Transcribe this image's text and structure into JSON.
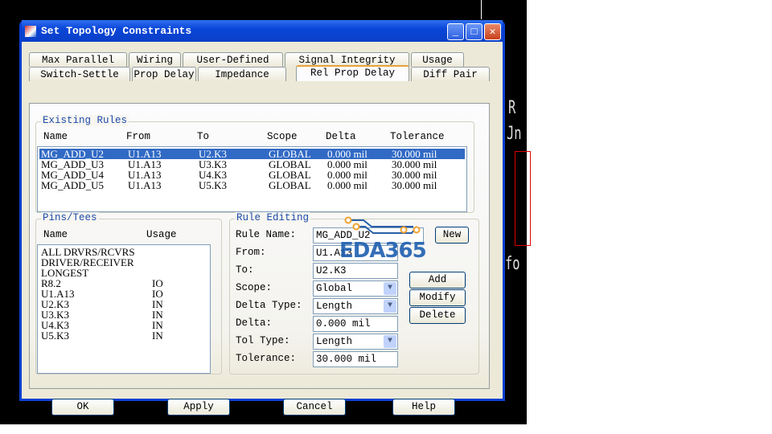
{
  "window": {
    "title": "Set Topology Constraints"
  },
  "tabs_row1": [
    "Max Parallel",
    "Wiring",
    "User-Defined",
    "Signal Integrity",
    "Usage"
  ],
  "tabs_row2": [
    "Switch-Settle",
    "Prop Delay",
    "Impedance",
    "Rel Prop Delay",
    "Diff Pair"
  ],
  "existing_rules": {
    "legend": "Existing Rules",
    "columns": [
      "Name",
      "From",
      "To",
      "Scope",
      "Delta",
      "Tolerance"
    ],
    "rows": [
      [
        "MG_ADD_U2",
        "U1.A13",
        "U2.K3",
        "GLOBAL",
        "0.000 mil",
        "30.000 mil"
      ],
      [
        "MG_ADD_U3",
        "U1.A13",
        "U3.K3",
        "GLOBAL",
        "0.000 mil",
        "30.000 mil"
      ],
      [
        "MG_ADD_U4",
        "U1.A13",
        "U4.K3",
        "GLOBAL",
        "0.000 mil",
        "30.000 mil"
      ],
      [
        "MG_ADD_U5",
        "U1.A13",
        "U5.K3",
        "GLOBAL",
        "0.000 mil",
        "30.000 mil"
      ]
    ]
  },
  "pins_tees": {
    "legend": "Pins/Tees",
    "columns": [
      "Name",
      "Usage"
    ],
    "rows": [
      [
        "ALL DRVRS/RCVRS",
        ""
      ],
      [
        "DRIVER/RECEIVER",
        ""
      ],
      [
        "LONGEST",
        ""
      ],
      [
        "R8.2",
        "IO"
      ],
      [
        "U1.A13",
        "IO"
      ],
      [
        "U2.K3",
        "IN"
      ],
      [
        "U3.K3",
        "IN"
      ],
      [
        "U4.K3",
        "IN"
      ],
      [
        "U5.K3",
        "IN"
      ]
    ]
  },
  "rule_editing": {
    "legend": "Rule Editing",
    "rule_name_label": "Rule Name:",
    "rule_name": "MG_ADD_U2",
    "from_label": "From:",
    "from": "U1.A13",
    "to_label": "To:",
    "to": "U2.K3",
    "scope_label": "Scope:",
    "scope": "Global",
    "delta_type_label": "Delta Type:",
    "delta_type": "Length",
    "delta_label": "Delta:",
    "delta": "0.000 mil",
    "tol_type_label": "Tol Type:",
    "tol_type": "Length",
    "tolerance_label": "Tolerance:",
    "tolerance": "30.000 mil",
    "new": "New",
    "add": "Add",
    "modify": "Modify",
    "delete": "Delete"
  },
  "buttons": {
    "ok": "OK",
    "apply": "Apply",
    "cancel": "Cancel",
    "help": "Help"
  },
  "watermark": "EDA365"
}
